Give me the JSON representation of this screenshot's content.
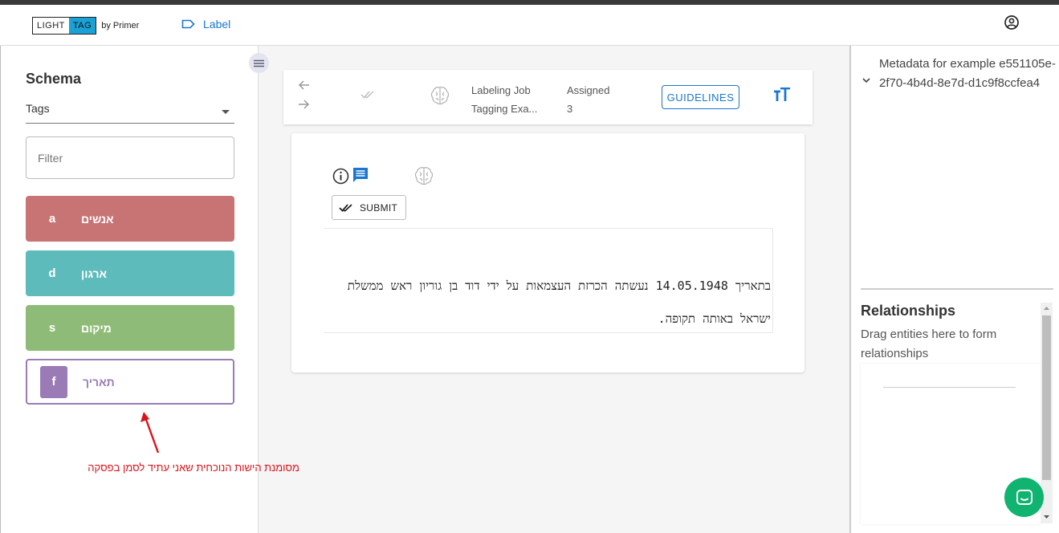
{
  "app": {
    "logo_light": "LIGHT",
    "logo_tag": "TAG",
    "logo_by": "by Primer",
    "nav_label": "Label"
  },
  "sidebar": {
    "title": "Schema",
    "select_value": "Tags",
    "filter_placeholder": "Filter",
    "tags": [
      {
        "key": "a",
        "name": "אנשים",
        "color": "#c97474"
      },
      {
        "key": "d",
        "name": "ארגון",
        "color": "#5dbcbb"
      },
      {
        "key": "s",
        "name": "מיקום",
        "color": "#8fbb78"
      },
      {
        "key": "f",
        "name": "תאריך",
        "color": "#9a7bb6"
      }
    ],
    "annotation": "מסומנת הישות הנוכחית שאני עתיד לסמן בפסקה"
  },
  "toolbar": {
    "job_label": "Labeling Job",
    "job_value": "Tagging Exa...",
    "assigned_label": "Assigned",
    "assigned_value": "3",
    "guidelines_label": "GUIDELINES"
  },
  "card": {
    "submit_label": "SUBMIT",
    "text_line1": "בתאריך 14.05.1948 נעשתה הכרזת העצמאות על ידי דוד בן גוריון ראש ממשלת",
    "text_line2": "ישראל באותה תקופה."
  },
  "right": {
    "metadata": "Metadata for example e551105e-2f70-4b4d-8e7d-d1c9f8ccfea4",
    "rel_title": "Relationships",
    "rel_sub": "Drag entities here to form relationships"
  },
  "colors": {
    "accent": "#1976d2",
    "annotation": "#d8141c",
    "chat": "#10b36f"
  }
}
